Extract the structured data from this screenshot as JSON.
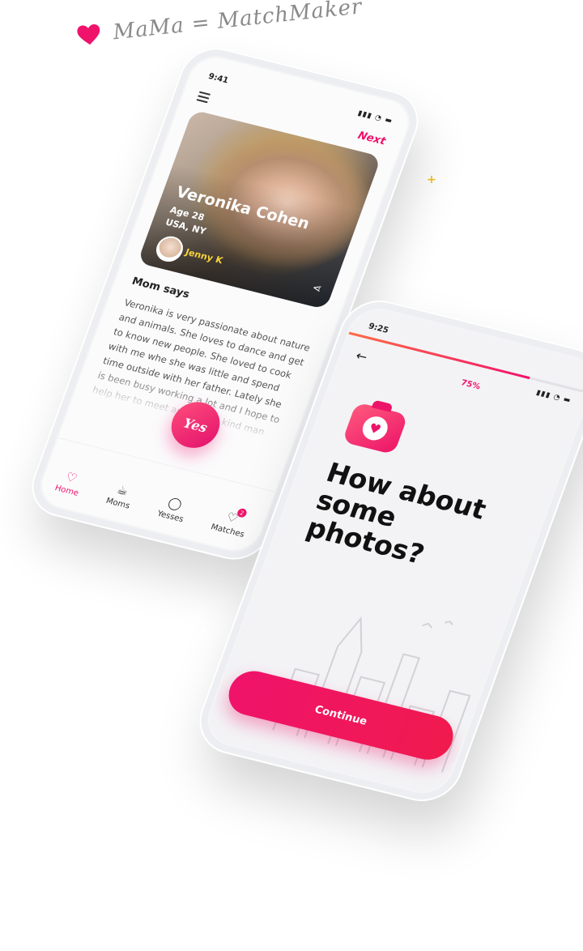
{
  "brand": {
    "logo_icon": "heart-icon",
    "title": "MaMa = MatchMaker",
    "accent": "#f0136b"
  },
  "profile_screen": {
    "status_time": "9:41",
    "next_label": "Next",
    "card": {
      "name": "Veronika Cohen",
      "age": "Age 28",
      "location": "USA, NY",
      "referrer": "Jenny K"
    },
    "mom_says_title": "Mom says",
    "mom_says_text": "Veronika is very passionate about nature and animals. She loves to dance and get to know new people. She loved to cook with me whe she was little and spend time outside with her father. Lately she is been busy working a lot and I hope to help her to meet an honest, kind man",
    "yes_label": "Yes",
    "tabs": [
      {
        "label": "Home",
        "icon": "double-heart-icon",
        "active": true
      },
      {
        "label": "Moms",
        "icon": "teacup-icon",
        "active": false
      },
      {
        "label": "Yesses",
        "icon": "chat-bubble-icon",
        "active": false
      },
      {
        "label": "Matches",
        "icon": "heart-chat-icon",
        "active": false,
        "badge": "2"
      }
    ]
  },
  "photos_screen": {
    "status_time": "9:25",
    "progress": 75,
    "progress_label": "75%",
    "headline": "How about some photos?",
    "continue_label": "Continue"
  }
}
